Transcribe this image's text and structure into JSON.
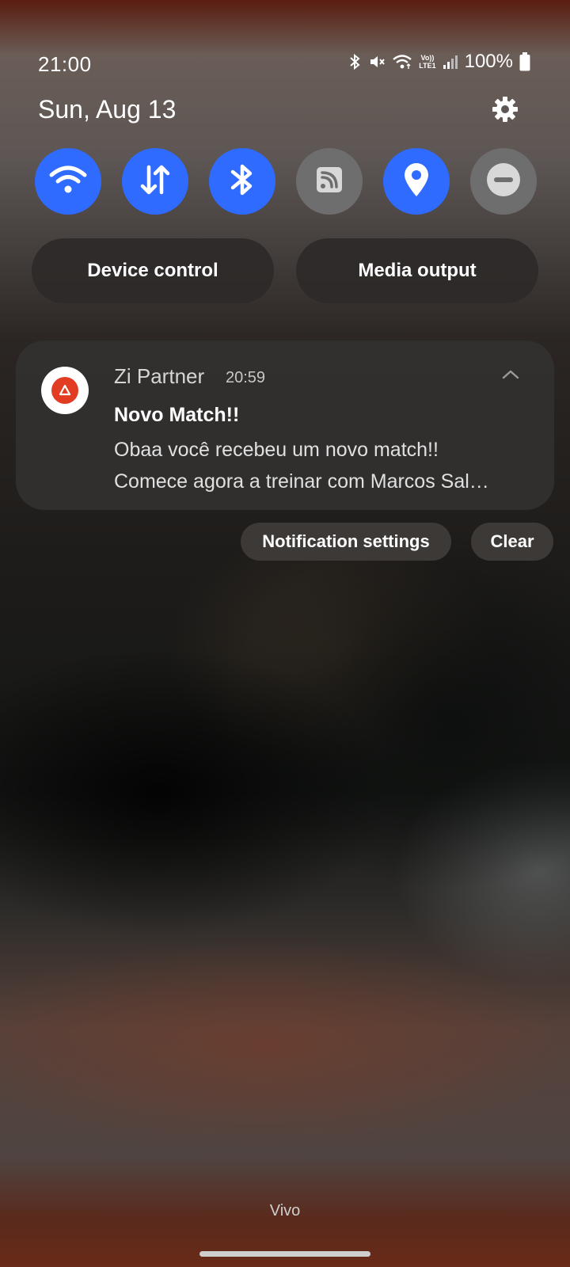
{
  "status_bar": {
    "time": "21:00",
    "volte_label_top": "Vo))",
    "volte_label_bottom": "LTE1",
    "battery": "100%",
    "icons": [
      "bluetooth-icon",
      "mute-icon",
      "wifi-icon",
      "volte-icon",
      "signal-icon",
      "battery-icon"
    ]
  },
  "panel": {
    "date": "Sun, Aug 13",
    "settings_icon": "gear-icon",
    "tiles": [
      {
        "name": "wifi",
        "icon": "wifi-icon",
        "on": true
      },
      {
        "name": "mobile-data",
        "icon": "data-arrows-icon",
        "on": true
      },
      {
        "name": "bluetooth",
        "icon": "bluetooth-icon",
        "on": true
      },
      {
        "name": "cast",
        "icon": "cast-icon",
        "on": false
      },
      {
        "name": "location",
        "icon": "location-pin-icon",
        "on": true
      },
      {
        "name": "do-not-disturb",
        "icon": "minus-circle-icon",
        "on": false
      }
    ],
    "device_control_label": "Device control",
    "media_output_label": "Media output"
  },
  "notification": {
    "app_name": "Zi Partner",
    "time": "20:59",
    "title": "Novo Match!!",
    "body_line1": "Obaa você recebeu um novo match!!",
    "body_line2": "Comece agora a treinar com Marcos Sal…"
  },
  "actions": {
    "notification_settings_label": "Notification settings",
    "clear_label": "Clear"
  },
  "carrier": "Vivo",
  "colors": {
    "tile_on": "#2f6bff",
    "tile_off": "#6e6e6e",
    "app_icon_accent": "#e23d22"
  }
}
